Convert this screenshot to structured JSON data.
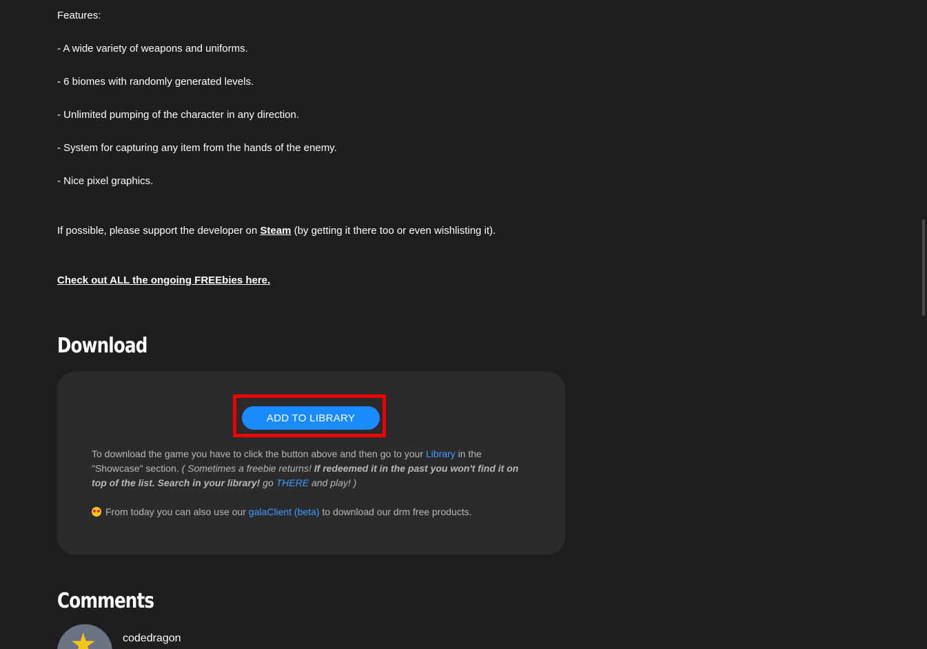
{
  "features": {
    "heading": "Features:",
    "items": [
      "- A wide variety of weapons and uniforms.",
      "- 6 biomes with randomly generated levels.",
      "- Unlimited pumping of the character in any direction.",
      "- System for capturing any item from the hands of the enemy.",
      "- Nice pixel graphics."
    ]
  },
  "support": {
    "before": "If possible, please support the developer on ",
    "link": "Steam",
    "after": " (by getting it there too or even wishlisting it)."
  },
  "freebies_link": "Check out ALL the ongoing FREEbies here.",
  "download": {
    "title": "Download",
    "button_label": "ADD TO LIBRARY",
    "instructions_1": "To download the game you have to click the button above and then go to your ",
    "library_link": "Library",
    "instructions_2": " in the \"Showcase\" section. ",
    "note_italic": "( Sometimes a freebie returns! ",
    "note_bold": "If redeemed it in the past you won't find it on top of the list. Search in your library!",
    "note_go": " go ",
    "there_link": "THERE",
    "note_end": " and play! )",
    "client_before": "From today you can also use our ",
    "client_link": "galaClient (beta)",
    "client_after": " to download our drm free products."
  },
  "comments": {
    "title": "Comments",
    "first_user": "codedragon"
  },
  "colors": {
    "background": "#1e1e20",
    "box": "#2b2b2e",
    "accent": "#1a8cff",
    "highlight": "#ee0000",
    "link": "#3d9bff"
  }
}
